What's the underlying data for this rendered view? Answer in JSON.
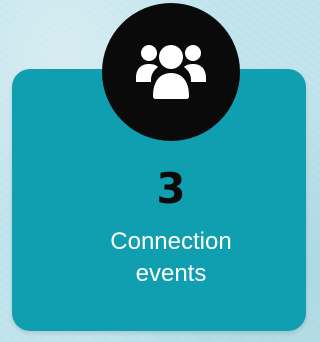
{
  "stat": {
    "icon": "users-icon",
    "value": "3",
    "label": "Connection events"
  },
  "colors": {
    "background": "#bfe3eb",
    "card": "#0f9fb0",
    "icon_circle": "#0a0a0a",
    "icon": "#ffffff",
    "value_text": "#0a0a0a",
    "label_text": "#ffffff"
  }
}
